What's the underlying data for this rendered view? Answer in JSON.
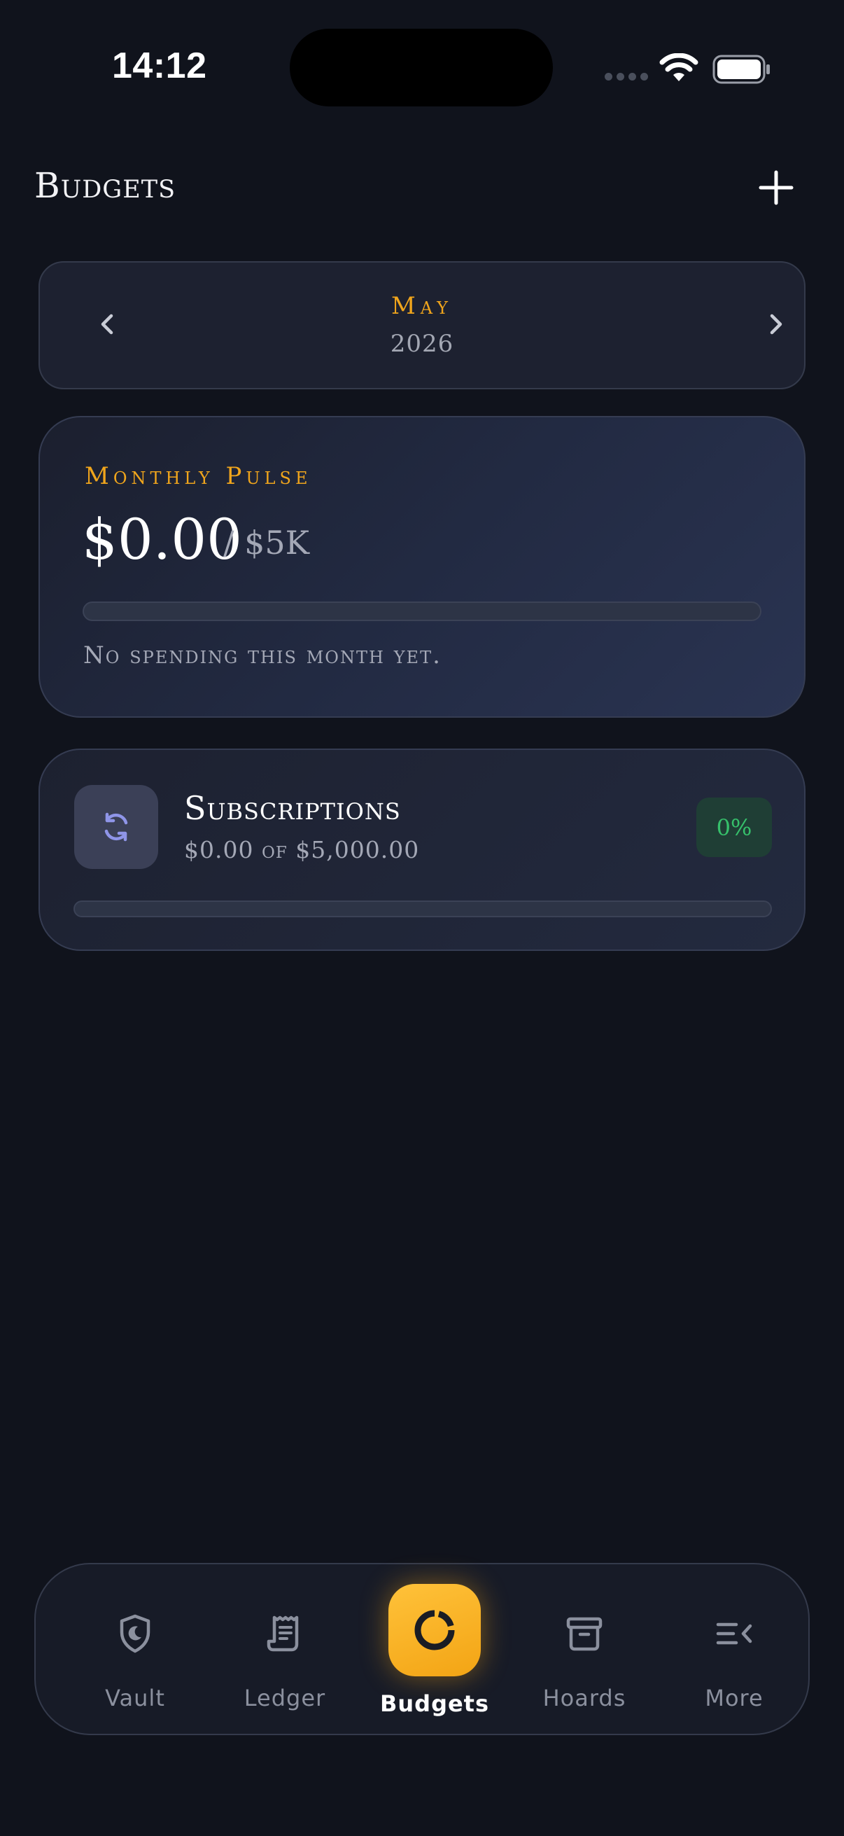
{
  "status_bar": {
    "time": "14:12"
  },
  "header": {
    "title": "Budgets"
  },
  "month_selector": {
    "month": "May",
    "year": "2026"
  },
  "monthly_pulse": {
    "label": "Monthly Pulse",
    "amount": "$0.00",
    "limit": "/ $5K",
    "progress": 0,
    "note": "No spending this month yet."
  },
  "categories": [
    {
      "name": "Subscriptions",
      "summary": "$0.00 of $5,000.00",
      "percent": "0%",
      "progress": 0,
      "icon": "refresh-icon"
    }
  ],
  "tabbar": {
    "items": [
      {
        "label": "Vault",
        "icon": "shield-moon-icon"
      },
      {
        "label": "Ledger",
        "icon": "receipt-icon"
      },
      {
        "label": "Budgets",
        "icon": "budget-ring-icon",
        "active": true
      },
      {
        "label": "Hoards",
        "icon": "archive-box-icon"
      },
      {
        "label": "More",
        "icon": "menu-collapse-icon"
      }
    ]
  },
  "colors": {
    "background": "#10131c",
    "accent": "#f0a51c",
    "success": "#36c06b",
    "muted_text": "#a4a8b6"
  }
}
